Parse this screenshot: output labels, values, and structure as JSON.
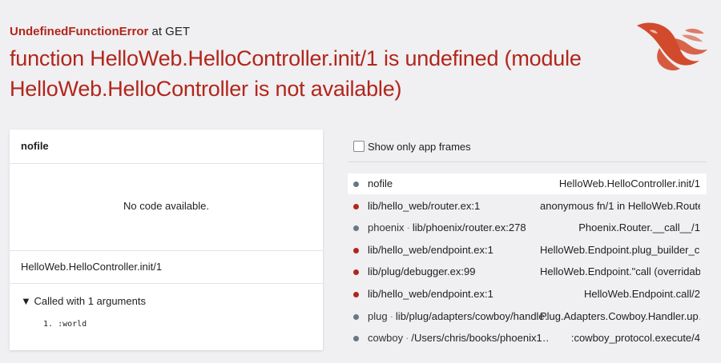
{
  "header": {
    "error_type": "UndefinedFunctionError",
    "at_label": "at GET",
    "message": "function HelloWeb.HelloController.init/1 is undefined (module HelloWeb.HelloController is not available)"
  },
  "logo": {
    "icon": "phoenix-logo-icon",
    "color": "#d24a2c"
  },
  "code_panel": {
    "file": "nofile",
    "no_code_text": "No code available.",
    "function": "HelloWeb.HelloController.init/1",
    "args_toggle_label": "Called with 1 arguments",
    "args": [
      {
        "index": "1.",
        "value": ":world"
      }
    ]
  },
  "frames": {
    "filter_label": "Show only app frames",
    "items": [
      {
        "kind": "dep",
        "app": "",
        "location": "nofile",
        "function": "HelloWeb.HelloController.init/1",
        "active": true
      },
      {
        "kind": "app",
        "app": "",
        "location": "lib/hello_web/router.ex:1",
        "function": "anonymous fn/1 in HelloWeb.Route…",
        "active": false
      },
      {
        "kind": "dep",
        "app": "phoenix",
        "location": "lib/phoenix/router.ex:278",
        "function": "Phoenix.Router.__call__/1",
        "active": false
      },
      {
        "kind": "app",
        "app": "",
        "location": "lib/hello_web/endpoint.ex:1",
        "function": "HelloWeb.Endpoint.plug_builder_c…",
        "active": false
      },
      {
        "kind": "app",
        "app": "",
        "location": "lib/plug/debugger.ex:99",
        "function": "HelloWeb.Endpoint.\"call (overridab…",
        "active": false
      },
      {
        "kind": "app",
        "app": "",
        "location": "lib/hello_web/endpoint.ex:1",
        "function": "HelloWeb.Endpoint.call/2",
        "active": false
      },
      {
        "kind": "dep",
        "app": "plug",
        "location": "lib/plug/adapters/cowboy/handle…",
        "function": "Plug.Adapters.Cowboy.Handler.up…",
        "active": false
      },
      {
        "kind": "dep",
        "app": "cowboy",
        "location": "/Users/chris/books/phoenix1…",
        "function": ":cowboy_protocol.execute/4",
        "active": false
      }
    ]
  }
}
